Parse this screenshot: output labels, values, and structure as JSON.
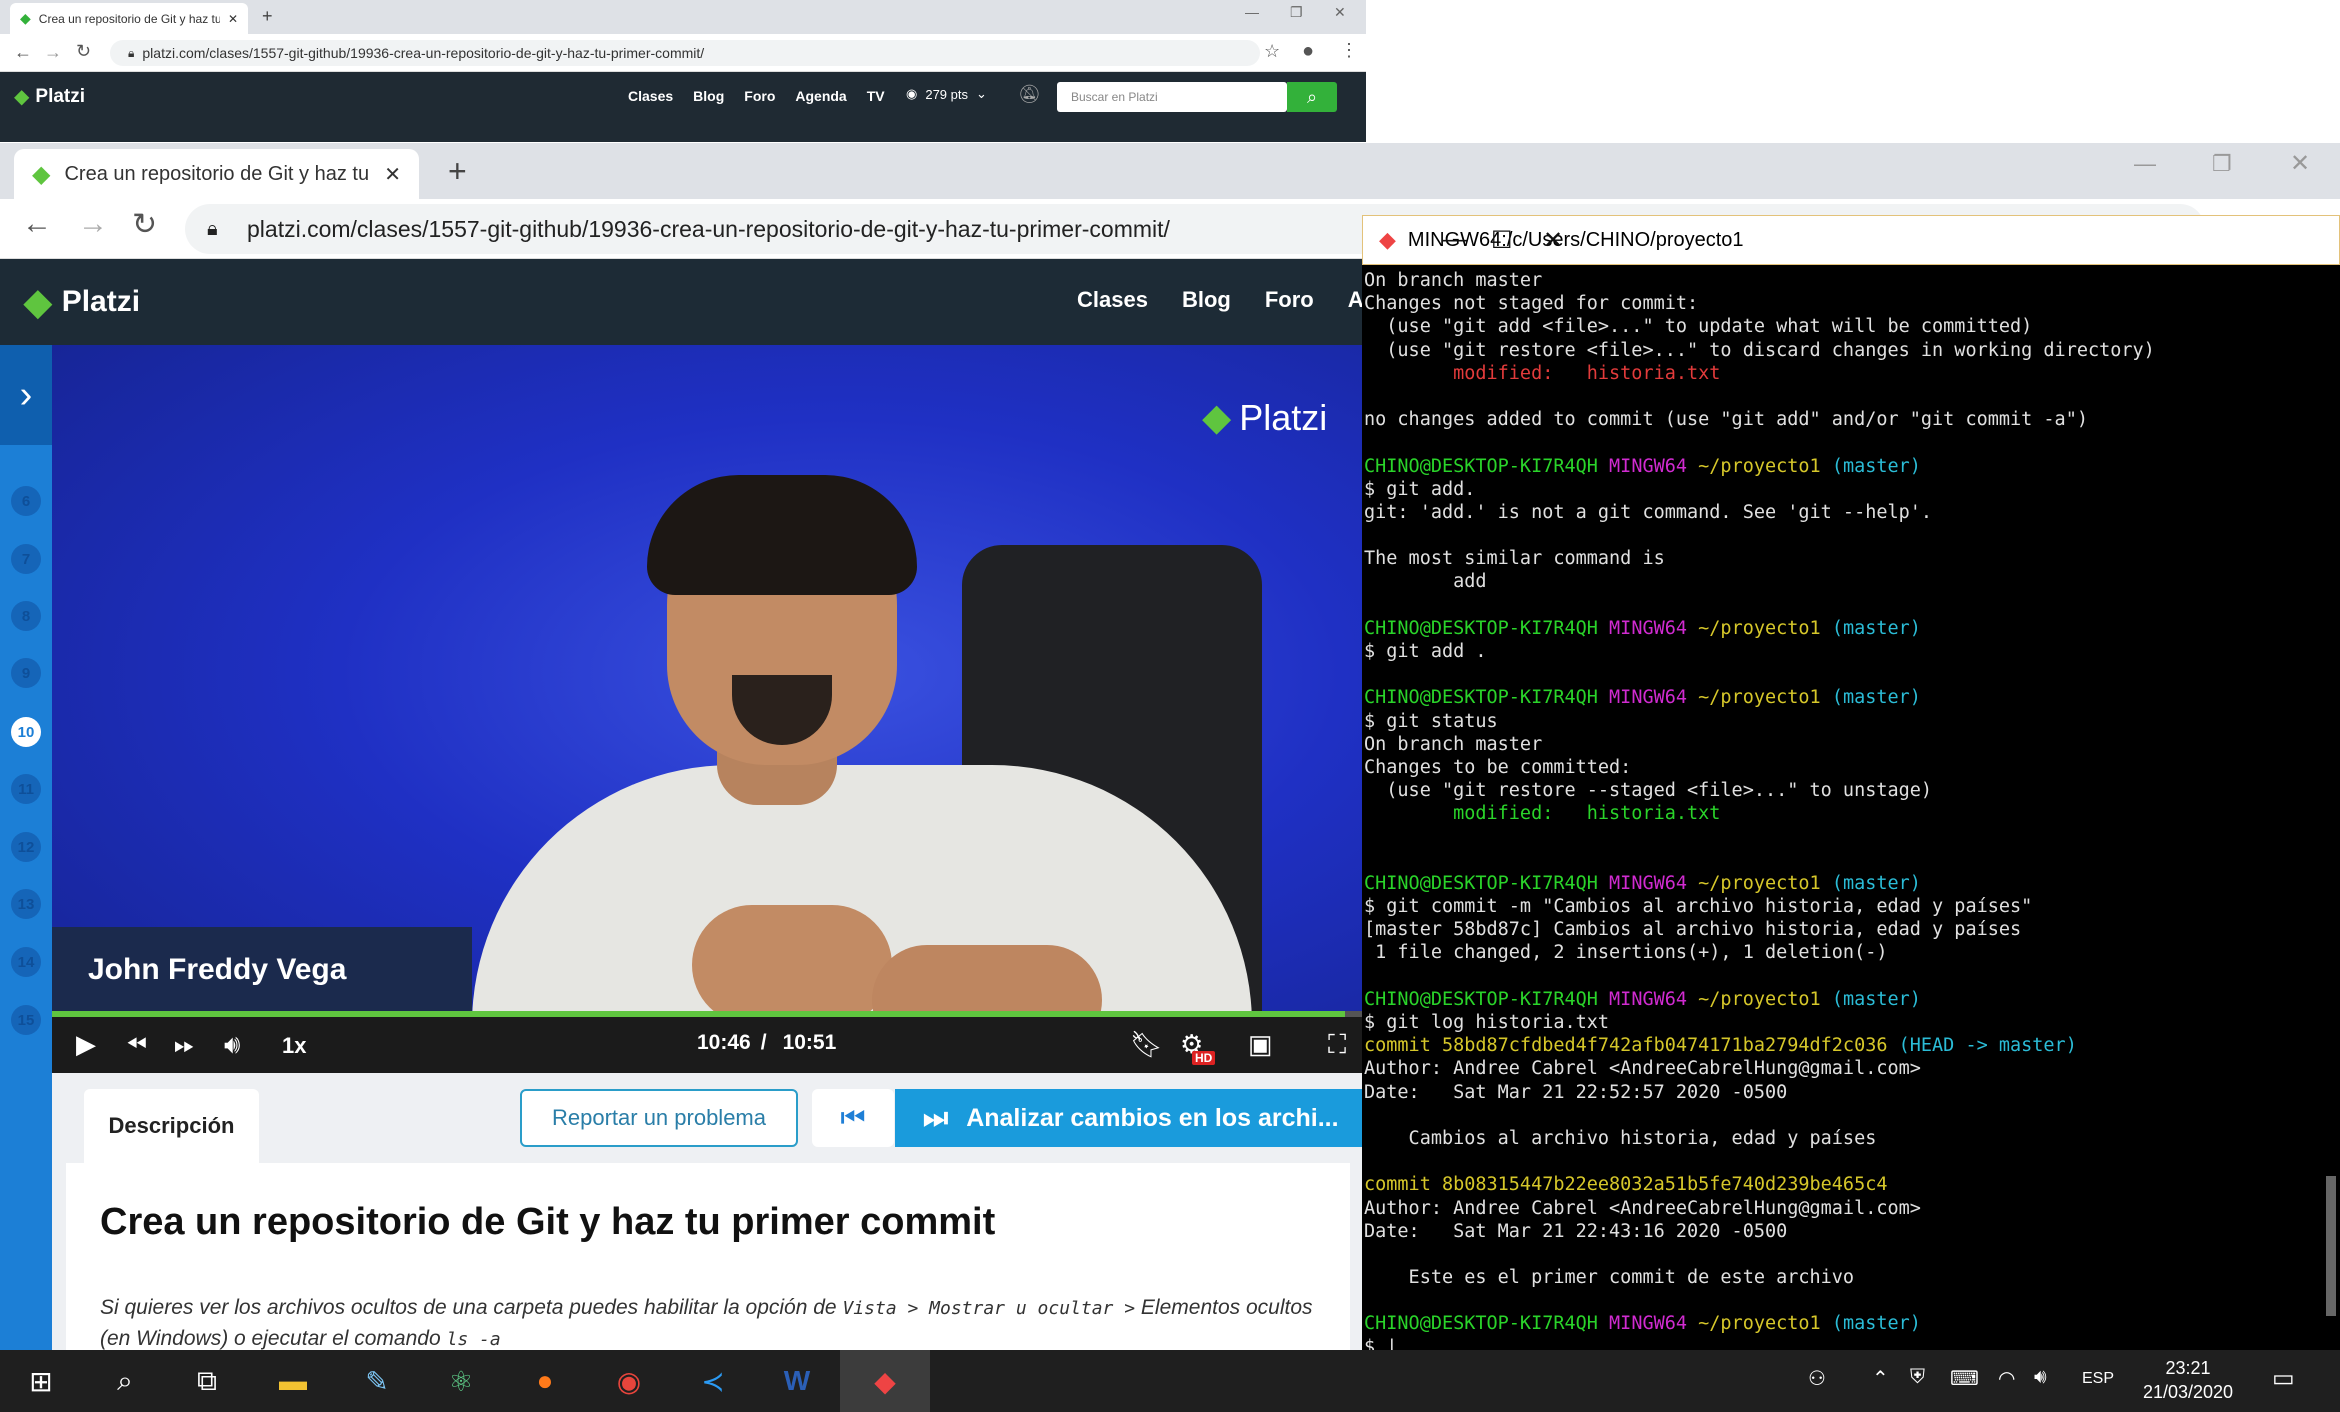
{
  "back_browser": {
    "tab_title": "Crea un repositorio de Git y haz tu",
    "url": "platzi.com/clases/1557-git-github/19936-crea-un-repositorio-de-git-y-haz-tu-primer-commit/",
    "logo": "Platzi",
    "nav": [
      "Clases",
      "Blog",
      "Foro",
      "Agenda",
      "TV"
    ],
    "points": "279 pts",
    "search_placeholder": "Buscar en Platzi"
  },
  "front_browser": {
    "tab_title": "Crea un repositorio de Git y haz tu",
    "url": "platzi.com/clases/1557-git-github/19936-crea-un-repositorio-de-git-y-haz-tu-primer-commit/",
    "logo": "Platzi",
    "nav": [
      "Clases",
      "Blog",
      "Foro",
      "Ag"
    ]
  },
  "sidebar": {
    "steps": [
      "6",
      "7",
      "8",
      "9",
      "10",
      "11",
      "12",
      "13",
      "14",
      "15"
    ],
    "active_step": "10"
  },
  "video": {
    "watermark": "Platzi",
    "speaker": "John Freddy Vega",
    "speed": "1x",
    "current_time": "10:46",
    "separator": "/",
    "duration": "10:51",
    "progress": 0.984,
    "hd_badge": "HD",
    "accent": "#5fc53f"
  },
  "lesson": {
    "tab_description": "Descripción",
    "report_button": "Reportar un problema",
    "next_button": "Analizar cambios en los archi...",
    "title": "Crea un repositorio de Git y haz tu primer commit",
    "text_1": "Si quieres ver los archivos ocultos de una carpeta puedes habilitar la opción de",
    "code_1": "Vista > Mostrar u ocultar >",
    "text_2": "Elementos ocultos (en Windows) o ejecutar el comando",
    "code_2": "ls -a"
  },
  "terminal": {
    "title": "MINGW64:/c/Users/CHINO/proyecto1",
    "prompt_user": "CHINO@DESKTOP-KI7R4QH",
    "prompt_env": "MINGW64",
    "prompt_path": "~/proyecto1",
    "prompt_branch": "(master)",
    "lines": [
      {
        "k": "w",
        "t": "On branch master"
      },
      {
        "k": "w",
        "t": "Changes not staged for commit:"
      },
      {
        "k": "w",
        "t": "  (use \"git add <file>...\" to update what will be committed)"
      },
      {
        "k": "w",
        "t": "  (use \"git restore <file>...\" to discard changes in working directory)"
      },
      {
        "k": "r",
        "t": "        modified:   historia.txt"
      },
      {
        "k": "w",
        "t": ""
      },
      {
        "k": "w",
        "t": "no changes added to commit (use \"git add\" and/or \"git commit -a\")"
      },
      {
        "k": "w",
        "t": ""
      },
      {
        "k": "p"
      },
      {
        "k": "w",
        "t": "$ git add."
      },
      {
        "k": "w",
        "t": "git: 'add.' is not a git command. See 'git --help'."
      },
      {
        "k": "w",
        "t": ""
      },
      {
        "k": "w",
        "t": "The most similar command is"
      },
      {
        "k": "w",
        "t": "        add"
      },
      {
        "k": "w",
        "t": ""
      },
      {
        "k": "p"
      },
      {
        "k": "w",
        "t": "$ git add ."
      },
      {
        "k": "w",
        "t": ""
      },
      {
        "k": "p"
      },
      {
        "k": "w",
        "t": "$ git status"
      },
      {
        "k": "w",
        "t": "On branch master"
      },
      {
        "k": "w",
        "t": "Changes to be committed:"
      },
      {
        "k": "w",
        "t": "  (use \"git restore --staged <file>...\" to unstage)"
      },
      {
        "k": "g",
        "t": "        modified:   historia.txt"
      },
      {
        "k": "w",
        "t": ""
      },
      {
        "k": "w",
        "t": ""
      },
      {
        "k": "p"
      },
      {
        "k": "w",
        "t": "$ git commit -m \"Cambios al archivo historia, edad y países\""
      },
      {
        "k": "w",
        "t": "[master 58bd87c] Cambios al archivo historia, edad y países"
      },
      {
        "k": "w",
        "t": " 1 file changed, 2 insertions(+), 1 deletion(-)"
      },
      {
        "k": "w",
        "t": ""
      },
      {
        "k": "p"
      },
      {
        "k": "w",
        "t": "$ git log historia.txt"
      },
      {
        "k": "commit",
        "t": "commit 58bd87cfdbed4f742afb0474171ba2794df2c036",
        "h": " (HEAD -> master)"
      },
      {
        "k": "w",
        "t": "Author: Andree Cabrel <AndreeCabrelHung@gmail.com>"
      },
      {
        "k": "w",
        "t": "Date:   Sat Mar 21 22:52:57 2020 -0500"
      },
      {
        "k": "w",
        "t": ""
      },
      {
        "k": "w",
        "t": "    Cambios al archivo historia, edad y países"
      },
      {
        "k": "w",
        "t": ""
      },
      {
        "k": "y",
        "t": "commit 8b08315447b22ee8032a51b5fe740d239be465c4"
      },
      {
        "k": "w",
        "t": "Author: Andree Cabrel <AndreeCabrelHung@gmail.com>"
      },
      {
        "k": "w",
        "t": "Date:   Sat Mar 21 22:43:16 2020 -0500"
      },
      {
        "k": "w",
        "t": ""
      },
      {
        "k": "w",
        "t": "    Este es el primer commit de este archivo"
      },
      {
        "k": "w",
        "t": ""
      },
      {
        "k": "p"
      },
      {
        "k": "w",
        "t": "$ |"
      }
    ]
  },
  "taskbar": {
    "language": "ESP",
    "time": "23:21",
    "date": "21/03/2020"
  }
}
